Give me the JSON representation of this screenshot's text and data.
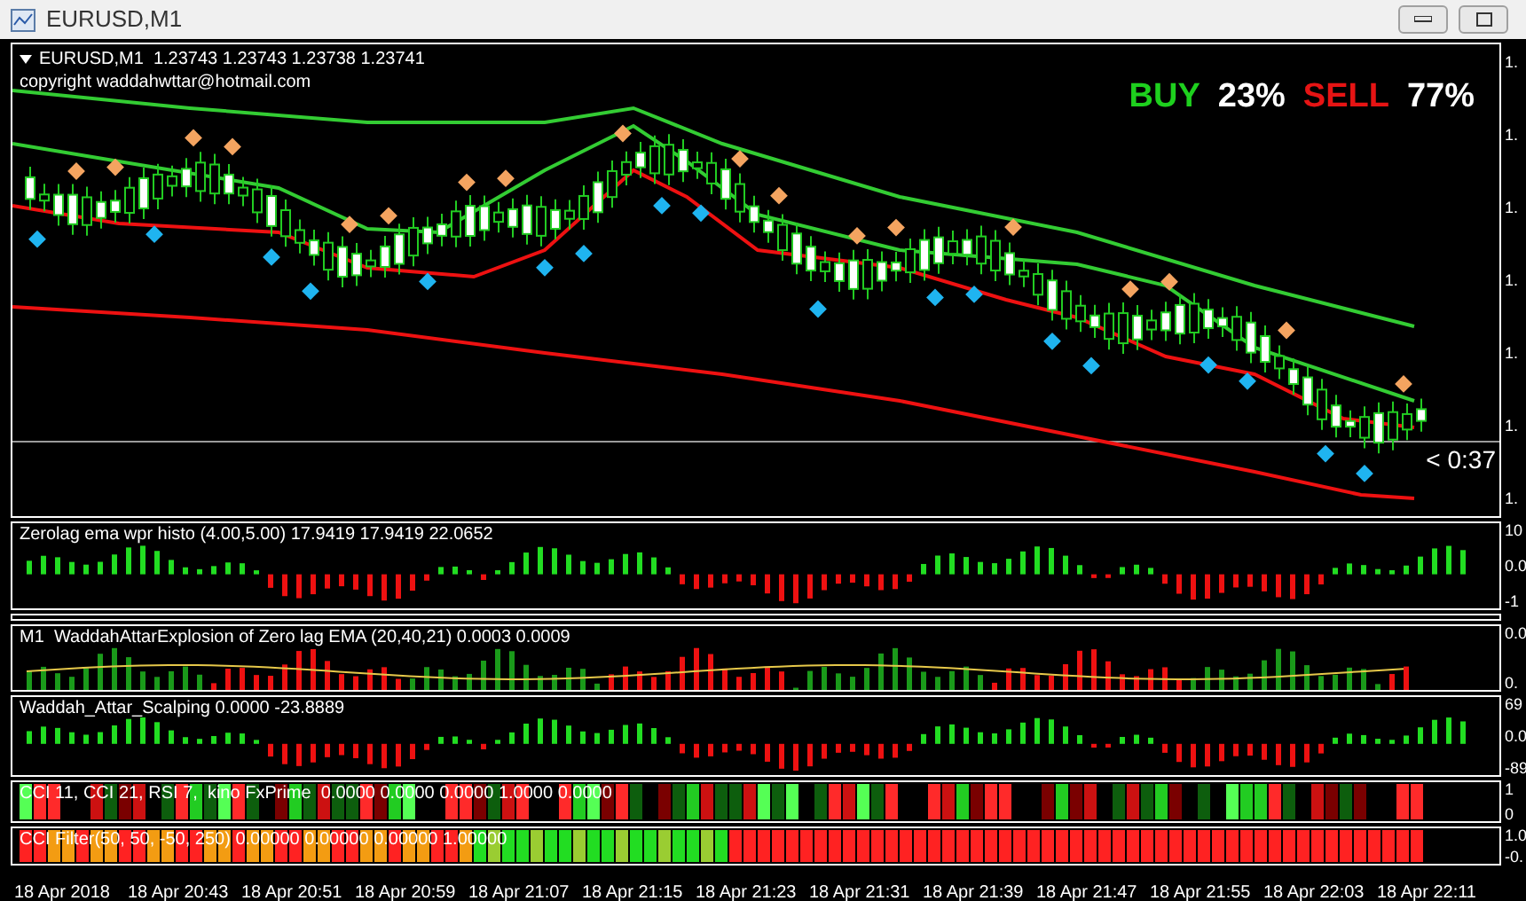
{
  "window": {
    "title": "EURUSD,M1"
  },
  "main_chart": {
    "header": "EURUSD,M1  1.23743 1.23743 1.23738 1.23741",
    "copyright": "copyright waddahwttar@hotmail.com",
    "signal": {
      "buy_label": "BUY",
      "buy_value": "23%",
      "sell_label": "SELL",
      "sell_value": "77%"
    },
    "countdown": "< 0:37",
    "price_axis": [
      "1.",
      "1.",
      "1.",
      "1.",
      "1.",
      "1.",
      "1."
    ]
  },
  "indicator_panes": [
    {
      "kind": "histo",
      "title": "Zerolag ema wpr histo (4.00,5.00) 17.9419 17.9419 22.0652",
      "axis": [
        "10",
        "0.0",
        "-1"
      ]
    },
    {
      "kind": "empty"
    },
    {
      "kind": "explosion",
      "title": "M1  WaddahAttarExplosion of Zero lag EMA (20,40,21) 0.0003 0.0009",
      "axis": [
        "0.0",
        "0."
      ]
    },
    {
      "kind": "histo",
      "title": "Waddah_Attar_Scalping 0.0000 -23.8889",
      "axis": [
        "69",
        "0.0",
        "-89"
      ]
    },
    {
      "kind": "blocks",
      "title": "CCI 11, CCI 21, RSI 7,  kino FxPrime  0.0000 0.0000 0.0000 1.0000 0.0000",
      "axis": [
        "1",
        "0"
      ]
    },
    {
      "kind": "filter",
      "title": "CCI Filter(50, 50, -50, 250) 0.00000 0.00000 0.00000 1.00000",
      "axis": [
        "1.0",
        "-0."
      ]
    }
  ],
  "time_axis": [
    "18 Apr 2018",
    "18 Apr 20:43",
    "18 Apr 20:51",
    "18 Apr 20:59",
    "18 Apr 21:07",
    "18 Apr 21:15",
    "18 Apr 21:23",
    "18 Apr 21:31",
    "18 Apr 21:39",
    "18 Apr 21:47",
    "18 Apr 21:55",
    "18 Apr 22:03",
    "18 Apr 22:11"
  ]
}
